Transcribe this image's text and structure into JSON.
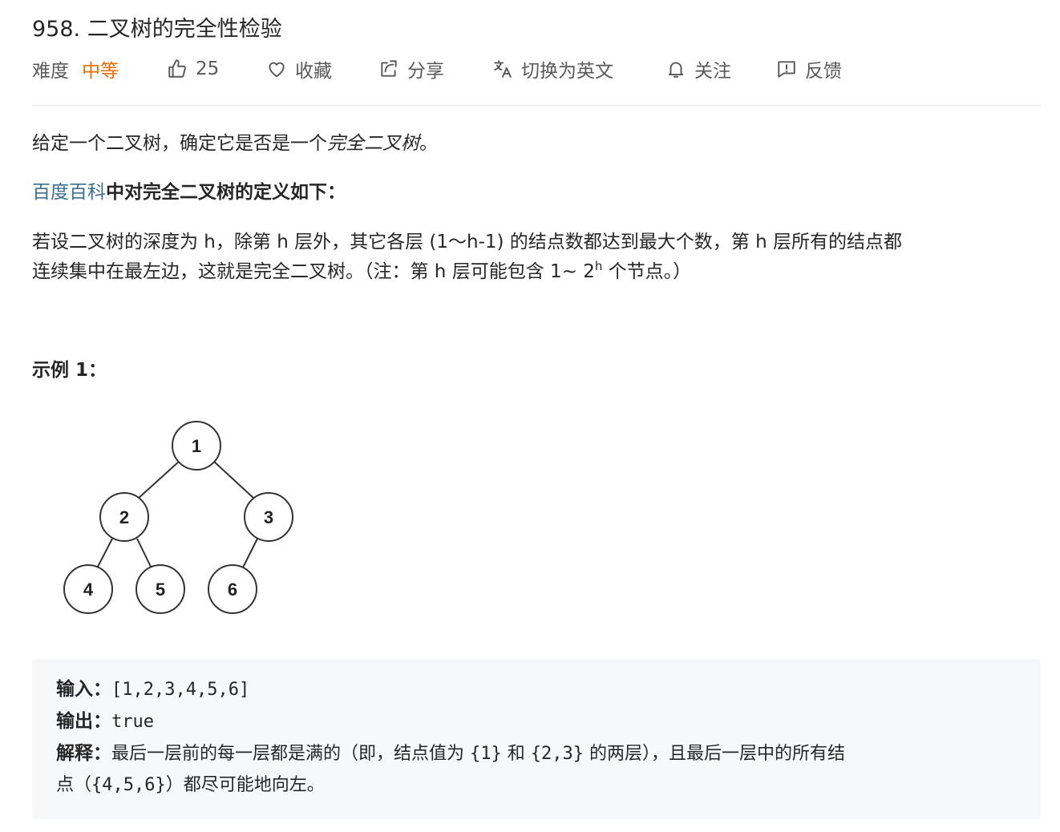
{
  "problem": {
    "title": "958. 二叉树的完全性检验"
  },
  "toolbar": {
    "difficulty_label": "难度",
    "difficulty_value": "中等",
    "like_count": "25",
    "favorite_label": "收藏",
    "share_label": "分享",
    "translate_label": "切换为英文",
    "follow_label": "关注",
    "feedback_label": "反馈",
    "difficulty_color": "#ef6c00"
  },
  "description": {
    "intro_text": "给定一个二叉树，确定它是否是一个",
    "intro_em": "完全二叉树",
    "intro_end": "。",
    "def_link": "百度百科",
    "def_rest": "中对完全二叉树的定义如下：",
    "def_line1": "若设二叉树的深度为 h，除第 h 层外，其它各层 (1～h-1) 的结点数都达到最大个数，第 h 层所有的结点都",
    "def_line2_a": "连续集中在最左边，这就是完全二叉树。（注：第 h 层可能包含 1~ 2",
    "def_line2_sup": "h",
    "def_line2_b": " 个节点。）"
  },
  "example": {
    "heading": "示例 1：",
    "tree_nodes": [
      "1",
      "2",
      "3",
      "4",
      "5",
      "6"
    ],
    "input_label": "输入：",
    "input_value": "[1,2,3,4,5,6]",
    "output_label": "输出：",
    "output_value": "true",
    "explain_label": "解释：",
    "explain_1": "最后一层前的每一层都是满的（即，结点值为 ",
    "explain_code1": "{1}",
    "explain_2": " 和 ",
    "explain_code2": "{2,3}",
    "explain_3": " 的两层），且最后一层中的所有结",
    "explain_4": "点（",
    "explain_code3": "{4,5,6}",
    "explain_5": "）都尽可能地向左。"
  }
}
